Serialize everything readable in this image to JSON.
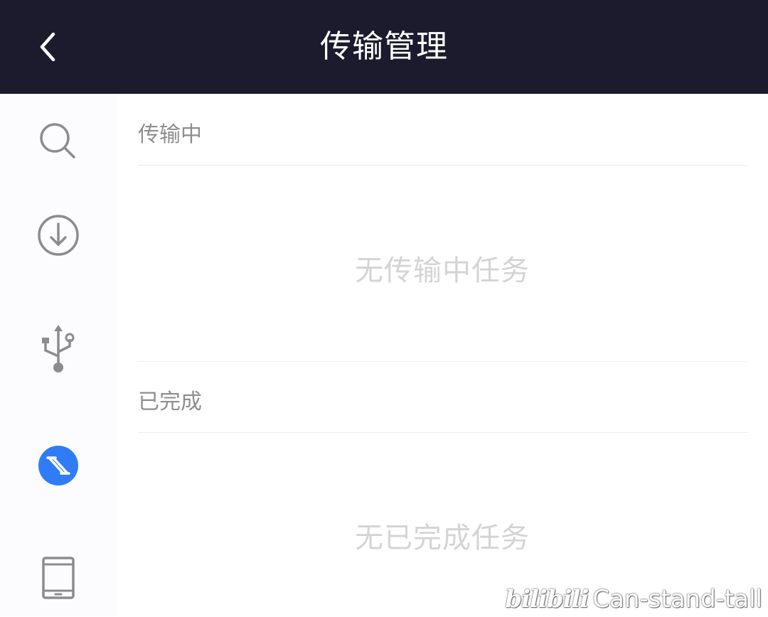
{
  "header": {
    "title": "传输管理",
    "back_icon": "chevron-left-icon"
  },
  "sidebar": {
    "items": [
      {
        "name": "search",
        "icon": "search-icon"
      },
      {
        "name": "download",
        "icon": "download-circle-icon"
      },
      {
        "name": "usb",
        "icon": "usb-icon"
      },
      {
        "name": "transfer",
        "icon": "transfer-icon",
        "active": true,
        "color": "#2f7cf6"
      },
      {
        "name": "tablet",
        "icon": "tablet-icon"
      }
    ]
  },
  "transferring": {
    "title": "传输中",
    "empty_text": "无传输中任务"
  },
  "completed": {
    "title": "已完成",
    "empty_text": "无已完成任务"
  },
  "watermark": {
    "logo": "bilibili",
    "text": "Can-stand-tall"
  },
  "colors": {
    "header_bg": "#1b1b2d",
    "accent": "#2f7cf6"
  }
}
